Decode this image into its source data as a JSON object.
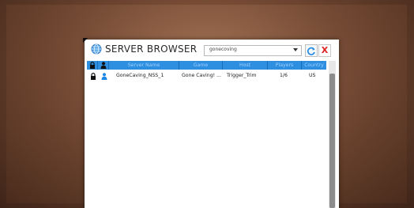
{
  "window": {
    "title": "SERVER BROWSER",
    "search": {
      "value": "gonecoving"
    },
    "close_label": "X"
  },
  "table": {
    "columns": [
      "Server Name",
      "Game",
      "Host",
      "Players",
      "Country"
    ],
    "rows": [
      {
        "server_name": "GoneCaving_NSS_1",
        "game": "Gone Caving! ...",
        "host": "Trigger_Trim",
        "players": "1/6",
        "country": "US"
      }
    ]
  },
  "colors": {
    "header_bg": "#2e8fe0",
    "accent": "#1e88e5",
    "close_red": "#d22222"
  },
  "icons": {
    "title": "globe-icon",
    "refresh": "refresh-icon",
    "close": "close-icon",
    "lock_column": "lock-icon",
    "player_column": "person-icon"
  }
}
